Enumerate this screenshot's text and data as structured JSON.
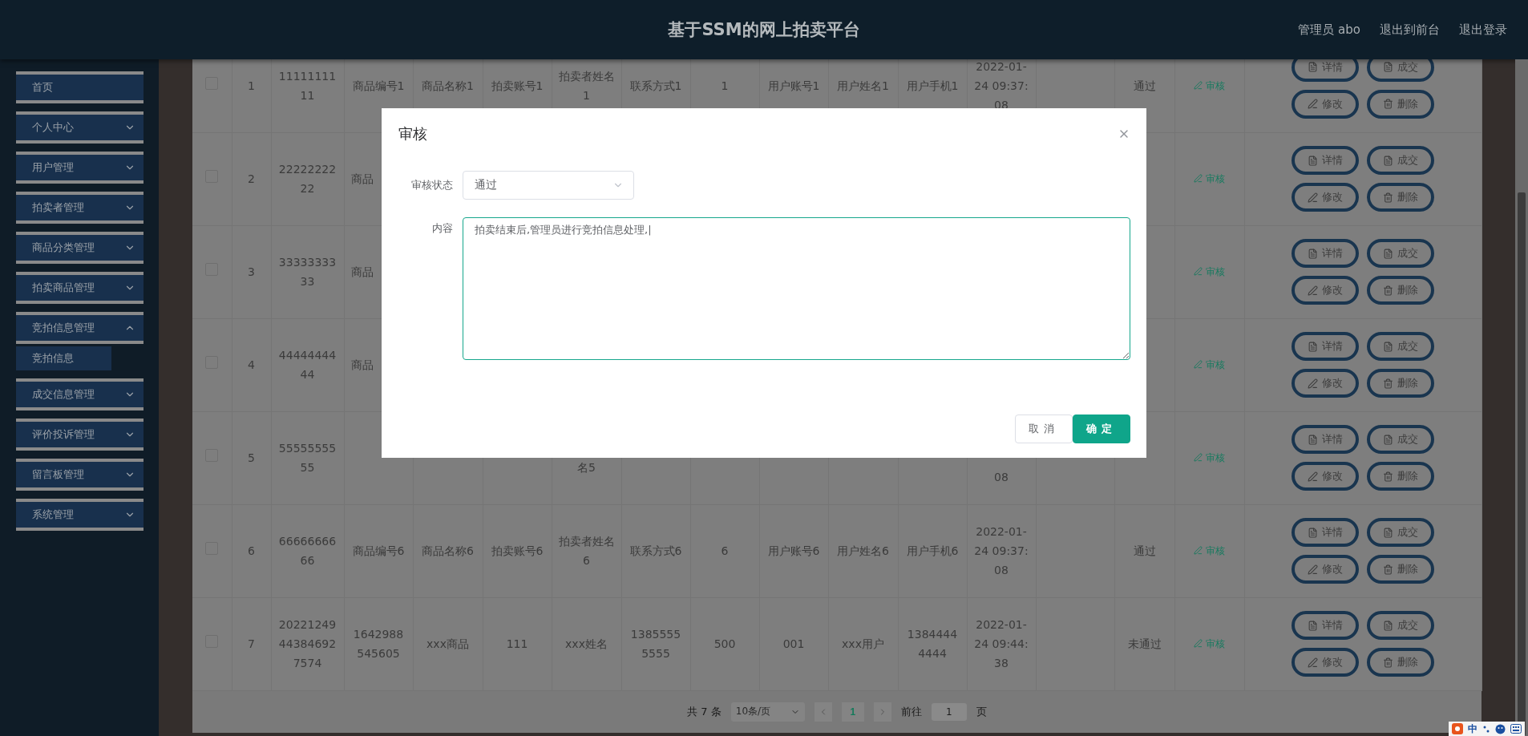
{
  "header": {
    "title": "基于SSM的网上拍卖平台",
    "links": [
      "管理员 abo",
      "退出到前台",
      "退出登录"
    ]
  },
  "sidebar": {
    "items": [
      {
        "label": "首页",
        "kind": "link"
      },
      {
        "label": "个人中心",
        "kind": "submenu",
        "expanded": false
      },
      {
        "label": "用户管理",
        "kind": "submenu",
        "expanded": false
      },
      {
        "label": "拍卖者管理",
        "kind": "submenu",
        "expanded": false
      },
      {
        "label": "商品分类管理",
        "kind": "submenu",
        "expanded": false
      },
      {
        "label": "拍卖商品管理",
        "kind": "submenu",
        "expanded": false
      },
      {
        "label": "竞拍信息管理",
        "kind": "submenu",
        "expanded": true,
        "children": [
          {
            "label": "竞拍信息"
          }
        ]
      },
      {
        "label": "成交信息管理",
        "kind": "submenu",
        "expanded": false
      },
      {
        "label": "评价投诉管理",
        "kind": "submenu",
        "expanded": false
      },
      {
        "label": "留言板管理",
        "kind": "submenu",
        "expanded": false
      },
      {
        "label": "系统管理",
        "kind": "submenu",
        "expanded": false
      }
    ]
  },
  "table": {
    "rows": [
      {
        "checked": false,
        "cells": {
          "column_2": "1",
          "column_3": "1111111111",
          "column_4": "商品编号1",
          "column_5": "商品名称1",
          "column_6": "拍卖账号1",
          "column_7": "拍卖者姓名1",
          "column_8": "联系方式1",
          "column_9": "1",
          "column_10": "用户账号1",
          "column_11": "用户姓名1",
          "column_12": "用户手机1",
          "column_13": "2022-01-24 09:37:08",
          "column_15": "通过"
        },
        "audit": "审核",
        "actions": [
          {
            "kind": "detail",
            "label": "详情"
          },
          {
            "kind": "detail",
            "label": "成交"
          },
          {
            "kind": "edit",
            "label": "修改"
          },
          {
            "kind": "delete",
            "label": "删除"
          }
        ]
      },
      {
        "checked": false,
        "cells": {
          "column_2": "2",
          "column_3": "2222222222",
          "column_4": {
            "text": "商品",
            "kind": "head"
          }
        },
        "audit": "审核",
        "actions": [
          {
            "kind": "detail",
            "label": "详情"
          },
          {
            "kind": "detail",
            "label": "成交"
          },
          {
            "kind": "edit",
            "label": "修改"
          },
          {
            "kind": "delete",
            "label": "删除"
          }
        ]
      },
      {
        "checked": false,
        "cells": {
          "column_2": "3",
          "column_3": "3333333333",
          "column_4": {
            "text": "商品",
            "kind": "head"
          }
        },
        "audit": "审核",
        "actions": [
          {
            "kind": "detail",
            "label": "详情"
          },
          {
            "kind": "detail",
            "label": "成交"
          },
          {
            "kind": "edit",
            "label": "修改"
          },
          {
            "kind": "delete",
            "label": "删除"
          }
        ]
      },
      {
        "checked": false,
        "cells": {
          "column_2": "4",
          "column_3": "4444444444",
          "column_4": {
            "text": "商品",
            "kind": "head"
          }
        },
        "audit": "审核",
        "actions": [
          {
            "kind": "detail",
            "label": "详情"
          },
          {
            "kind": "detail",
            "label": "成交"
          },
          {
            "kind": "edit",
            "label": "修改"
          },
          {
            "kind": "delete",
            "label": "删除"
          }
        ]
      },
      {
        "checked": false,
        "cells": {
          "column_2": "5",
          "column_3": "5555555555",
          "column_7": {
            "text": "名5",
            "kind": "second_line"
          },
          "column_13": {
            "text": "08",
            "kind": "third_line"
          }
        },
        "audit": "审核",
        "actions": [
          {
            "kind": "detail",
            "label": "详情"
          },
          {
            "kind": "detail",
            "label": "成交"
          },
          {
            "kind": "edit",
            "label": "修改"
          },
          {
            "kind": "delete",
            "label": "删除"
          }
        ]
      },
      {
        "checked": false,
        "cells": {
          "column_2": "6",
          "column_3": "6666666666",
          "column_4": "商品编号6",
          "column_5": "商品名称6",
          "column_6": "拍卖账号6",
          "column_7": "拍卖者姓名6",
          "column_8": "联系方式6",
          "column_9": "6",
          "column_10": "用户账号6",
          "column_11": "用户姓名6",
          "column_12": "用户手机6",
          "column_13": "2022-01-24 09:37:08",
          "column_15": "通过"
        },
        "audit": "审核",
        "actions": [
          {
            "kind": "detail",
            "label": "详情"
          },
          {
            "kind": "detail",
            "label": "成交"
          },
          {
            "kind": "edit",
            "label": "修改"
          },
          {
            "kind": "delete",
            "label": "删除"
          }
        ]
      },
      {
        "checked": false,
        "cells": {
          "column_2": "7",
          "column_3": "20221249443846927574",
          "column_4": "1642988545605",
          "column_5": "xxx商品",
          "column_6": "111",
          "column_7": "xxx姓名",
          "column_8": "13855555555",
          "column_9": "500",
          "column_10": "001",
          "column_11": "xxx用户",
          "column_12": "13844444444",
          "column_13": "2022-01-24 09:44:38",
          "column_15": "未通过"
        },
        "audit": "审核",
        "actions": [
          {
            "kind": "detail",
            "label": "详情"
          },
          {
            "kind": "detail",
            "label": "成交"
          },
          {
            "kind": "edit",
            "label": "修改"
          },
          {
            "kind": "delete",
            "label": "删除"
          }
        ]
      }
    ]
  },
  "pagination": {
    "total": "共 7 条",
    "page_size": "10条/页",
    "pages": [
      {
        "label": "1",
        "selected": true
      }
    ],
    "goto_label": "前往",
    "goto_value": "1",
    "goto_suffix": "页"
  },
  "dialog": {
    "title": "审核",
    "status_label": "审核状态",
    "status_value": "通过",
    "content_label": "内容",
    "content_value": "拍卖结束后,管理员进行竞拍信息处理,|",
    "buttons": [
      {
        "kind": "cancel",
        "label": "取消"
      },
      {
        "kind": "primary",
        "label": "确定"
      }
    ]
  },
  "ime_bar": {
    "mode": "中"
  }
}
